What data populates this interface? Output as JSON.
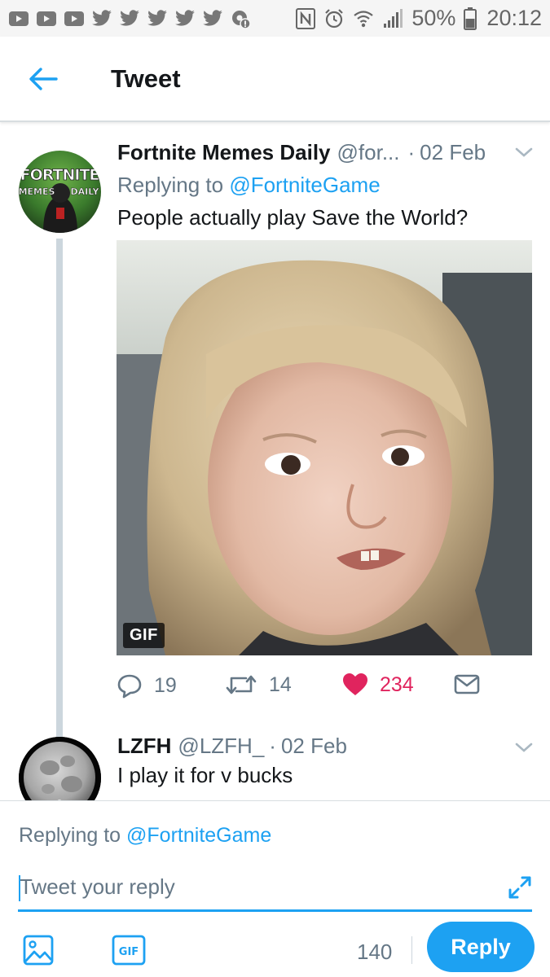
{
  "status_bar": {
    "battery_percent": "50%",
    "time": "20:12",
    "left_icons": [
      "youtube-icon",
      "youtube-icon",
      "youtube-icon",
      "twitter-icon",
      "twitter-icon",
      "twitter-icon",
      "twitter-icon",
      "twitter-icon",
      "settings-notification-icon"
    ],
    "right_icons": [
      "nfc-icon",
      "alarm-icon",
      "wifi-icon",
      "signal-icon",
      "battery-icon"
    ]
  },
  "header": {
    "title": "Tweet"
  },
  "tweet": {
    "author_name": "Fortnite Memes Daily",
    "handle": "@for...",
    "separator": "·",
    "date": "02 Feb",
    "replying_prefix": "Replying to ",
    "replying_to": "@FortniteGame",
    "text": "People actually play Save the World?",
    "avatar_text_line1": "FORTNITE",
    "avatar_text_line2": "MEMES",
    "avatar_text_line3": "DAILY",
    "media_badge": "GIF",
    "actions": {
      "replies": "19",
      "retweets": "14",
      "likes": "234"
    },
    "colors": {
      "like": "#e0245e",
      "accent": "#1da1f2"
    }
  },
  "reply": {
    "author_name": "LZFH",
    "handle": "@LZFH_",
    "separator": "·",
    "date": "02 Feb",
    "text": "I play it for v bucks"
  },
  "composer": {
    "replying_prefix": "Replying to ",
    "replying_to": "@FortniteGame",
    "placeholder": "Tweet your reply",
    "gif_label": "GIF",
    "char_count": "140",
    "reply_button": "Reply"
  }
}
